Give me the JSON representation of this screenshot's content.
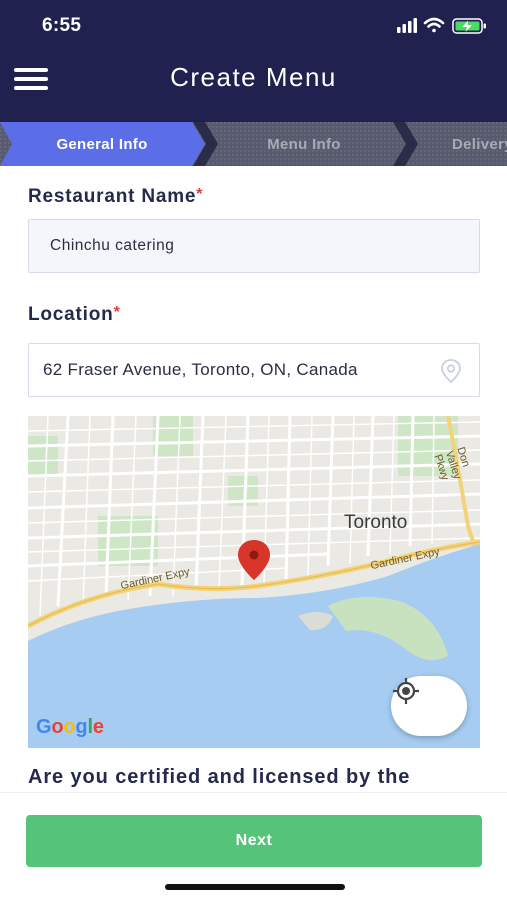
{
  "status_bar": {
    "time": "6:55",
    "icons": [
      "signal-icon",
      "wifi-icon",
      "battery-charging-icon"
    ]
  },
  "header": {
    "title": "Create Menu",
    "menu_icon": "hamburger-menu-icon"
  },
  "stepper": {
    "steps": [
      {
        "label": "General Info",
        "state": "active"
      },
      {
        "label": "Menu Info",
        "state": "inactive"
      },
      {
        "label": "Delivery",
        "state": "inactive"
      }
    ]
  },
  "form": {
    "restaurant_name": {
      "label": "Restaurant Name",
      "required_mark": "*",
      "value": "Chinchu catering"
    },
    "location": {
      "label": "Location",
      "required_mark": "*",
      "value": "62 Fraser Avenue, Toronto, ON, Canada",
      "icon": "location-pin-icon"
    },
    "map": {
      "city_label": "Toronto",
      "road_labels": [
        "Gardiner Expy",
        "Gardiner Expy",
        "Don Valley Pkwy"
      ],
      "attribution": "Google",
      "pin_icon": "map-marker-icon",
      "my_location_icon": "my-location-icon"
    },
    "question": "Are you certified and licensed by the"
  },
  "footer": {
    "next_label": "Next"
  },
  "colors": {
    "header_bg": "#20214f",
    "step_active": "#5b6ee8",
    "step_inactive": "#5a5b70",
    "next_button": "#55c47a",
    "required": "#e03c3c"
  }
}
